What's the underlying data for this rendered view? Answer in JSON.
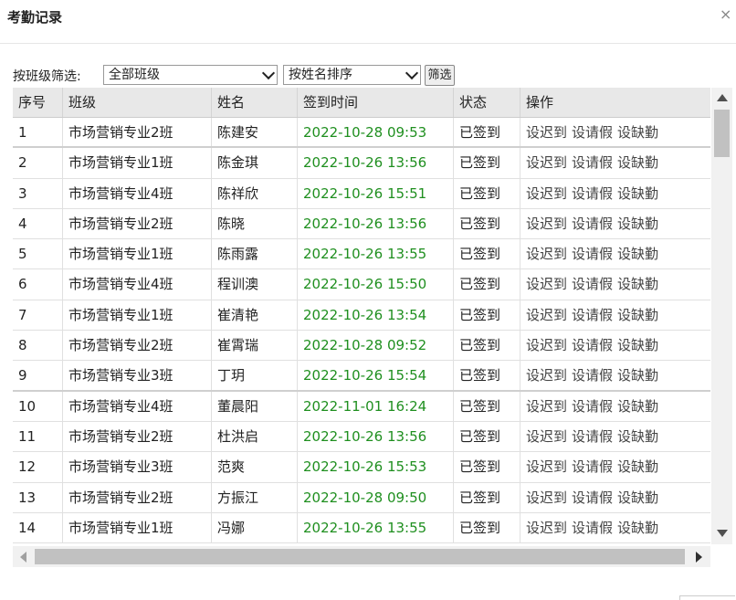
{
  "dialog": {
    "title": "考勤记录",
    "close_glyph": "×"
  },
  "filter": {
    "label": "按班级筛选:",
    "class_select": "全部班级",
    "sort_select": "按姓名排序",
    "button": "筛选"
  },
  "table": {
    "headers": [
      "序号",
      "班级",
      "姓名",
      "签到时间",
      "状态",
      "操作"
    ],
    "rows": [
      {
        "no": "1",
        "cls": "市场营销专业2班",
        "name": "陈建安",
        "time": "2022-10-28 09:53",
        "status": "已签到"
      },
      {
        "no": "2",
        "cls": "市场营销专业1班",
        "name": "陈金琪",
        "time": "2022-10-26 13:56",
        "status": "已签到"
      },
      {
        "no": "3",
        "cls": "市场营销专业4班",
        "name": "陈祥欣",
        "time": "2022-10-26 15:51",
        "status": "已签到"
      },
      {
        "no": "4",
        "cls": "市场营销专业2班",
        "name": "陈晓",
        "time": "2022-10-26 13:56",
        "status": "已签到"
      },
      {
        "no": "5",
        "cls": "市场营销专业1班",
        "name": "陈雨露",
        "time": "2022-10-26 13:55",
        "status": "已签到"
      },
      {
        "no": "6",
        "cls": "市场营销专业4班",
        "name": "程训澳",
        "time": "2022-10-26 15:50",
        "status": "已签到"
      },
      {
        "no": "7",
        "cls": "市场营销专业1班",
        "name": "崔清艳",
        "time": "2022-10-26 13:54",
        "status": "已签到"
      },
      {
        "no": "8",
        "cls": "市场营销专业2班",
        "name": "崔霄瑞",
        "time": "2022-10-28 09:52",
        "status": "已签到"
      },
      {
        "no": "9",
        "cls": "市场营销专业3班",
        "name": "丁玥",
        "time": "2022-10-26 15:54",
        "status": "已签到"
      },
      {
        "no": "10",
        "cls": "市场营销专业4班",
        "name": "董晨阳",
        "time": "2022-11-01 16:24",
        "status": "已签到"
      },
      {
        "no": "11",
        "cls": "市场营销专业2班",
        "name": "杜洪启",
        "time": "2022-10-26 13:56",
        "status": "已签到"
      },
      {
        "no": "12",
        "cls": "市场营销专业3班",
        "name": "范爽",
        "time": "2022-10-26 15:53",
        "status": "已签到"
      },
      {
        "no": "13",
        "cls": "市场营销专业2班",
        "name": "方振江",
        "time": "2022-10-28 09:50",
        "status": "已签到"
      },
      {
        "no": "14",
        "cls": "市场营销专业1班",
        "name": "冯娜",
        "time": "2022-10-26 13:55",
        "status": "已签到"
      }
    ],
    "actions": [
      "设迟到",
      "设请假",
      "设缺勤"
    ]
  },
  "colors": {
    "time": "#1f8f1f",
    "header_bg": "#e8e8e8"
  }
}
